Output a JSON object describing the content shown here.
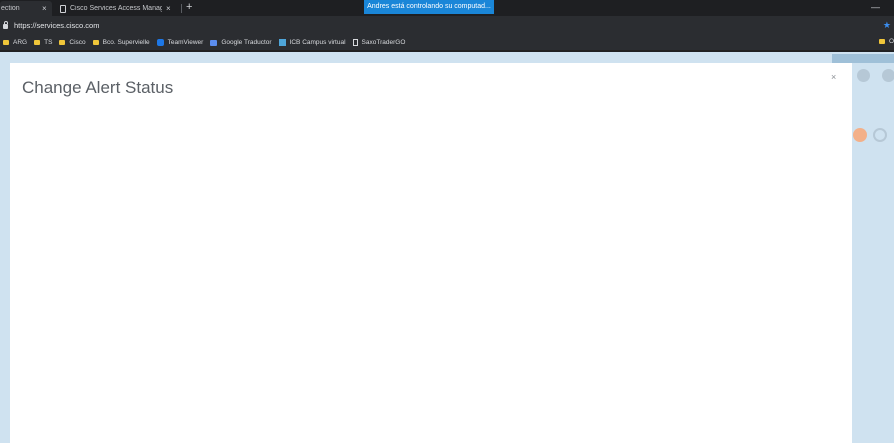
{
  "browser": {
    "tabs": [
      {
        "title": "ection",
        "close": "×"
      },
      {
        "title": "Cisco Services Access Manageme",
        "close": "×"
      }
    ],
    "new_tab": "+",
    "remote_banner": "Andres está controlando su computad...",
    "minimize": "—",
    "url": "https://services.cisco.com",
    "bookmarks": [
      {
        "label": "ARG",
        "icon": "folder-icon"
      },
      {
        "label": "TS",
        "icon": "folder-icon"
      },
      {
        "label": "Cisco",
        "icon": "folder-icon"
      },
      {
        "label": "Bco. Supervielle",
        "icon": "folder-icon"
      },
      {
        "label": "TeamViewer",
        "icon": "teamviewer-icon"
      },
      {
        "label": "Google Traductor",
        "icon": "google-translate-icon"
      },
      {
        "label": "ICB Campus virtual",
        "icon": "icb-icon"
      },
      {
        "label": "SaxoTraderGO",
        "icon": "page-icon"
      }
    ],
    "other_bookmarks": "O"
  },
  "modal": {
    "title": "Change Alert Status",
    "close": "×"
  },
  "colors": {
    "banner": "#1a86d8",
    "page_background": "#cfe2f0",
    "modal_background": "#ffffff",
    "title_text": "#5b6066"
  }
}
